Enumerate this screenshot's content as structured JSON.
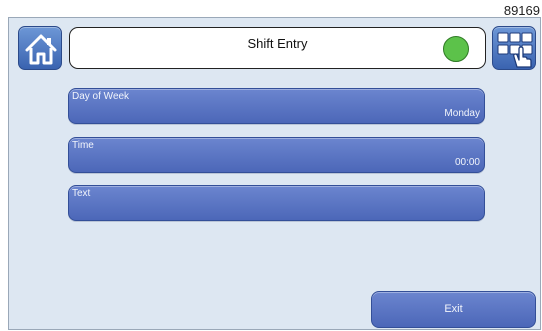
{
  "screen_id": "89169",
  "header": {
    "title": "Shift Entry",
    "status_color": "#5cc24a",
    "home_icon": "home-icon",
    "keypad_icon": "keypad-touch-icon"
  },
  "fields": [
    {
      "label": "Day of Week",
      "value": "Monday"
    },
    {
      "label": "Time",
      "value": "00:00"
    },
    {
      "label": "Text",
      "value": ""
    }
  ],
  "footer": {
    "exit_label": "Exit"
  },
  "colors": {
    "accent": "#4c67b8",
    "background": "#dde7f2",
    "status_ok": "#5cc24a"
  }
}
